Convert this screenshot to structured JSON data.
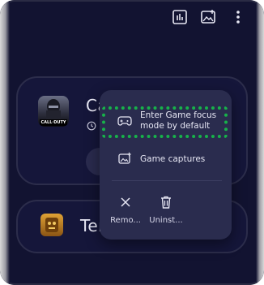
{
  "top_bar": {
    "icons": [
      "bar-chart-icon",
      "gallery-icon",
      "more-vert-icon"
    ]
  },
  "games": [
    {
      "title": "Ca",
      "icon_text": "CALL·DUTY"
    },
    {
      "title": "Ter"
    }
  ],
  "menu": {
    "items": [
      {
        "icon": "gamepad-icon",
        "label_line1": "Enter Game focus",
        "label_line2": "mode by default"
      },
      {
        "icon": "game-captures-icon",
        "label": "Game captures"
      }
    ],
    "actions": [
      {
        "icon": "close-icon",
        "label": "Remo..."
      },
      {
        "icon": "trash-icon",
        "label": "Uninst..."
      }
    ]
  },
  "colors": {
    "background": "#121331",
    "card_border": "#2c2d4b",
    "menu_bg": "#2a2c4e",
    "highlight": "#17b24a"
  }
}
